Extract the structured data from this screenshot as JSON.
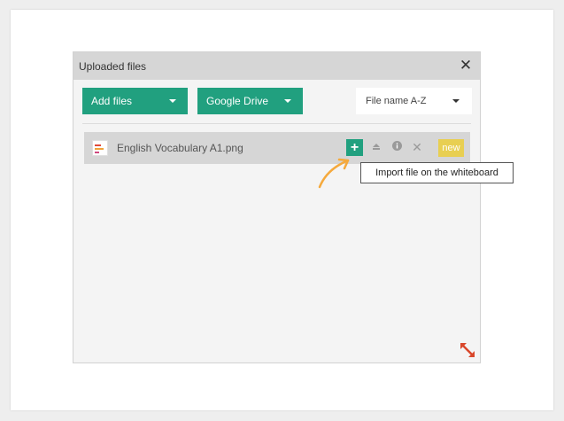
{
  "dialog": {
    "title": "Uploaded files",
    "add_files_label": "Add files",
    "google_drive_label": "Google Drive",
    "sort_label": "File name A-Z"
  },
  "files": [
    {
      "name": "English Vocabulary A1.png",
      "badge": "new"
    }
  ],
  "tooltip": {
    "text": "Import file on the whiteboard"
  },
  "colors": {
    "accent": "#21a07f",
    "badge": "#e8cf52",
    "arrow": "#f5a93c",
    "resize": "#d9472b"
  },
  "icons": {
    "close": "close-icon",
    "import": "plus-icon",
    "eject": "eject-icon",
    "info": "info-icon",
    "delete": "x-icon",
    "resize": "resize-diagonal-icon"
  }
}
